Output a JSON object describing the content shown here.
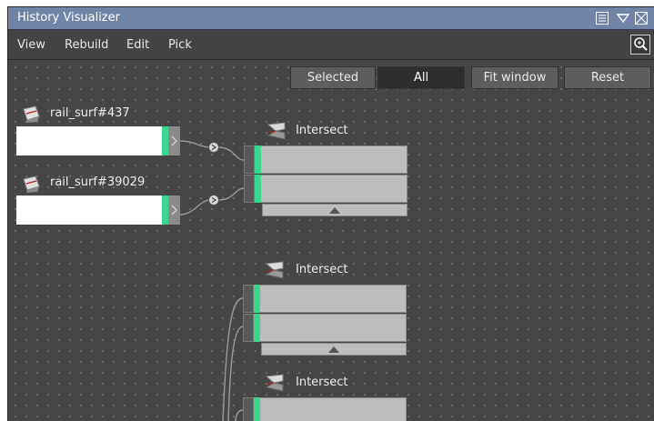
{
  "window": {
    "title": "History Visualizer"
  },
  "titlebar_icons": [
    "list-icon",
    "dropdown-triangle-icon",
    "close-icon"
  ],
  "menu": [
    "View",
    "Rebuild",
    "Edit",
    "Pick"
  ],
  "zoom_icon": "magnifier-icon",
  "toolbar": {
    "selected": "Selected",
    "all": "All",
    "fit_window": "Fit window",
    "reset": "Reset",
    "active": "All"
  },
  "sources": [
    {
      "label": "rail_surf#437",
      "icon": "surface-icon"
    },
    {
      "label": "rail_surf#39029",
      "icon": "surface-icon"
    }
  ],
  "nodes": [
    {
      "title": "Intersect",
      "icon": "intersect-icon"
    },
    {
      "title": "Intersect",
      "icon": "intersect-icon"
    },
    {
      "title": "Intersect",
      "icon": "intersect-icon"
    }
  ],
  "colors": {
    "accent_green": "#39d88c",
    "titlebar": "#6f84a6",
    "canvas": "#464646"
  }
}
